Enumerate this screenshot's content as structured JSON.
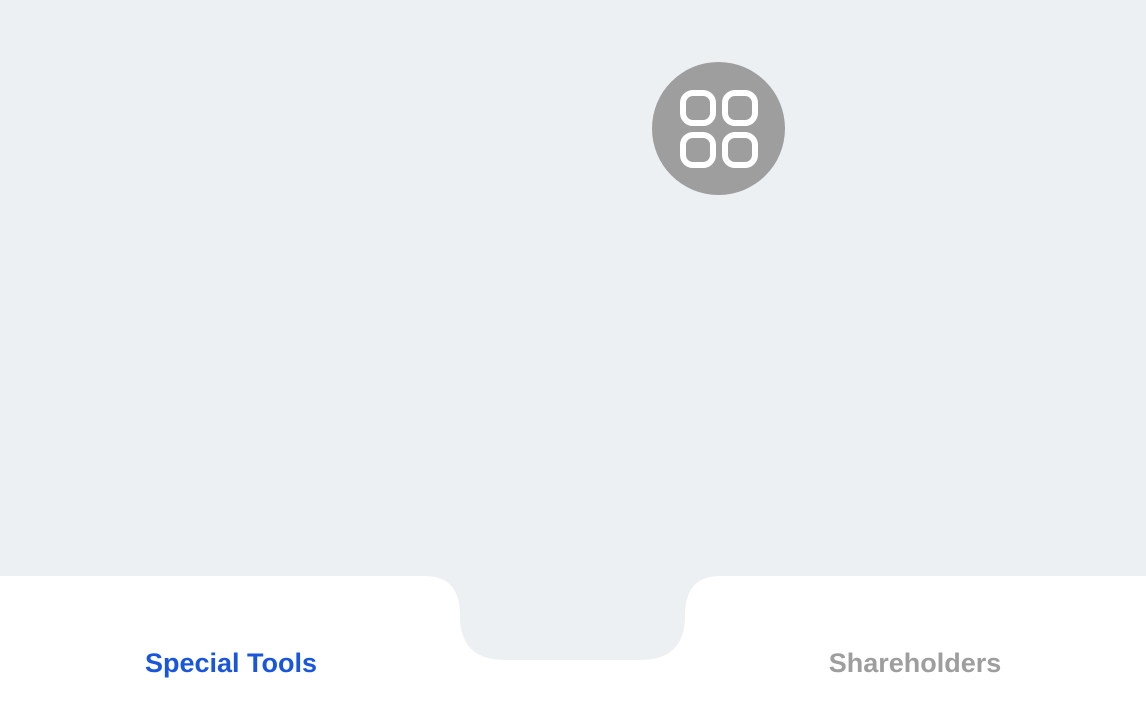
{
  "colors": {
    "background": "#edf0f3",
    "bar": "#ffffff",
    "fab": "#9e9e9e",
    "active_tab": "#1a56db",
    "inactive_tab": "#9e9e9e"
  },
  "fab": {
    "icon": "apps-grid-icon"
  },
  "bottom_nav": {
    "tabs": [
      {
        "label": "Special Tools",
        "active": true
      },
      {
        "label": "Shareholders",
        "active": false
      }
    ]
  }
}
